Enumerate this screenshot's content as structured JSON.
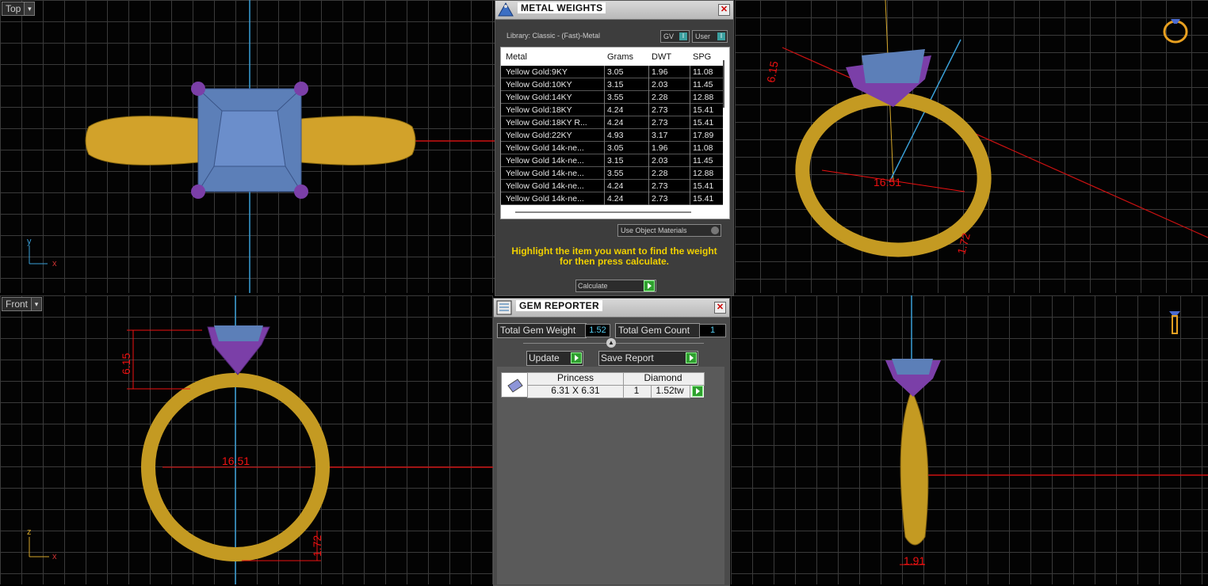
{
  "viewports": {
    "top": {
      "label": "Top",
      "axis_a": "y",
      "axis_b": "x"
    },
    "front": {
      "label": "Front",
      "axis_a": "z",
      "axis_b": "x",
      "dims": {
        "height": "6.15",
        "inner": "16.51",
        "band": "1.72"
      }
    },
    "perspective": {
      "dims": {
        "height": "6.15",
        "inner": "16.51",
        "band": "1.72"
      }
    },
    "side": {
      "dims": {
        "thickness": "1.91"
      }
    }
  },
  "metal_weights": {
    "title": "METAL WEIGHTS",
    "library": "Library: Classic - (Fast)-Metal",
    "gv_label": "GV",
    "user_label": "User",
    "columns": [
      "Metal",
      "Grams",
      "DWT",
      "SPG"
    ],
    "rows": [
      {
        "metal": "Yellow Gold:9KY",
        "grams": "3.05",
        "dwt": "1.96",
        "spg": "11.08"
      },
      {
        "metal": "Yellow Gold:10KY",
        "grams": "3.15",
        "dwt": "2.03",
        "spg": "11.45"
      },
      {
        "metal": "Yellow Gold:14KY",
        "grams": "3.55",
        "dwt": "2.28",
        "spg": "12.88"
      },
      {
        "metal": "Yellow Gold:18KY",
        "grams": "4.24",
        "dwt": "2.73",
        "spg": "15.41"
      },
      {
        "metal": "Yellow Gold:18KY R...",
        "grams": "4.24",
        "dwt": "2.73",
        "spg": "15.41"
      },
      {
        "metal": "Yellow Gold:22KY",
        "grams": "4.93",
        "dwt": "3.17",
        "spg": "17.89"
      },
      {
        "metal": "Yellow Gold 14k-ne...",
        "grams": "3.05",
        "dwt": "1.96",
        "spg": "11.08"
      },
      {
        "metal": "Yellow Gold 14k-ne...",
        "grams": "3.15",
        "dwt": "2.03",
        "spg": "11.45"
      },
      {
        "metal": "Yellow Gold 14k-ne...",
        "grams": "3.55",
        "dwt": "2.28",
        "spg": "12.88"
      },
      {
        "metal": "Yellow Gold 14k-ne...",
        "grams": "4.24",
        "dwt": "2.73",
        "spg": "15.41"
      },
      {
        "metal": "Yellow Gold 14k-ne...",
        "grams": "4.24",
        "dwt": "2.73",
        "spg": "15.41"
      }
    ],
    "use_object_materials": "Use Object Materials",
    "hint": "Highlight the item you want to find the weight for then press calculate.",
    "calculate_label": "Calculate"
  },
  "gem_reporter": {
    "title": "GEM REPORTER",
    "total_weight_label": "Total Gem Weight",
    "total_weight_value": "1.52",
    "total_count_label": "Total Gem Count",
    "total_count_value": "1",
    "update_label": "Update",
    "save_report_label": "Save Report",
    "gem": {
      "cut": "Princess",
      "material": "Diamond",
      "size": "6.31 X 6.31",
      "count": "1",
      "weight": "1.52tw"
    }
  },
  "colors": {
    "gold": "#d4a62a",
    "prong": "#7b3fa8",
    "gem": "#5c7fb8",
    "dimension": "#ee1111",
    "axis_blue": "#3aa0d8"
  }
}
